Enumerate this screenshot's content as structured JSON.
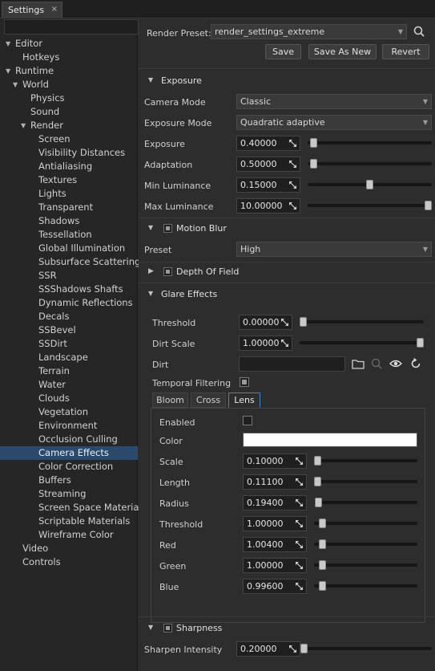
{
  "tab": {
    "title": "Settings",
    "close": "×"
  },
  "tree": [
    {
      "label": "Editor",
      "indent": 0,
      "arrow": "▼"
    },
    {
      "label": "Hotkeys",
      "indent": 1
    },
    {
      "label": "Runtime",
      "indent": 0,
      "arrow": "▼"
    },
    {
      "label": "World",
      "indent": 1,
      "arrow": "▼"
    },
    {
      "label": "Physics",
      "indent": 2
    },
    {
      "label": "Sound",
      "indent": 2
    },
    {
      "label": "Render",
      "indent": 2,
      "arrow": "▼"
    },
    {
      "label": "Screen",
      "indent": 3
    },
    {
      "label": "Visibility Distances",
      "indent": 3
    },
    {
      "label": "Antialiasing",
      "indent": 3
    },
    {
      "label": "Textures",
      "indent": 3
    },
    {
      "label": "Lights",
      "indent": 3
    },
    {
      "label": "Transparent",
      "indent": 3
    },
    {
      "label": "Shadows",
      "indent": 3
    },
    {
      "label": "Tessellation",
      "indent": 3
    },
    {
      "label": "Global Illumination",
      "indent": 3
    },
    {
      "label": "Subsurface Scattering",
      "indent": 3
    },
    {
      "label": "SSR",
      "indent": 3
    },
    {
      "label": "SSShadows Shafts",
      "indent": 3
    },
    {
      "label": "Dynamic Reflections",
      "indent": 3
    },
    {
      "label": "Decals",
      "indent": 3
    },
    {
      "label": "SSBevel",
      "indent": 3
    },
    {
      "label": "SSDirt",
      "indent": 3
    },
    {
      "label": "Landscape",
      "indent": 3
    },
    {
      "label": "Terrain",
      "indent": 3
    },
    {
      "label": "Water",
      "indent": 3
    },
    {
      "label": "Clouds",
      "indent": 3
    },
    {
      "label": "Vegetation",
      "indent": 3
    },
    {
      "label": "Environment",
      "indent": 3
    },
    {
      "label": "Occlusion Culling",
      "indent": 3
    },
    {
      "label": "Camera Effects",
      "indent": 3,
      "selected": true
    },
    {
      "label": "Color Correction",
      "indent": 3
    },
    {
      "label": "Buffers",
      "indent": 3
    },
    {
      "label": "Streaming",
      "indent": 3
    },
    {
      "label": "Screen Space Materials",
      "indent": 3
    },
    {
      "label": "Scriptable Materials",
      "indent": 3
    },
    {
      "label": "Wireframe Color",
      "indent": 3
    },
    {
      "label": "Video",
      "indent": 1
    },
    {
      "label": "Controls",
      "indent": 1
    }
  ],
  "preset": {
    "label": "Render Preset:",
    "value": "render_settings_extreme"
  },
  "buttons": {
    "save": "Save",
    "save_as_new": "Save As New",
    "revert": "Revert"
  },
  "exposure": {
    "title": "Exposure",
    "camera_mode_label": "Camera Mode",
    "camera_mode_value": "Classic",
    "exposure_mode_label": "Exposure Mode",
    "exposure_mode_value": "Quadratic adaptive",
    "rows": [
      {
        "label": "Exposure",
        "value": "0.40000",
        "pos": 0.02
      },
      {
        "label": "Adaptation",
        "value": "0.50000",
        "pos": 0.02
      },
      {
        "label": "Min Luminance",
        "value": "0.15000",
        "pos": 0.5
      },
      {
        "label": "Max Luminance",
        "value": "10.00000",
        "pos": 1.0
      }
    ]
  },
  "motion_blur": {
    "title": "Motion Blur",
    "preset_label": "Preset",
    "preset_value": "High"
  },
  "depth_of_field": {
    "title": "Depth Of Field"
  },
  "glare": {
    "title": "Glare Effects",
    "threshold_label": "Threshold",
    "threshold_value": "0.00000",
    "threshold_pos": 0.0,
    "dirt_scale_label": "Dirt Scale",
    "dirt_scale_value": "1.00000",
    "dirt_scale_pos": 1.0,
    "dirt_label": "Dirt",
    "dirt_value": "",
    "temporal_label": "Temporal Filtering",
    "tabs": [
      "Bloom",
      "Cross",
      "Lens"
    ],
    "lens": {
      "enabled_label": "Enabled",
      "color_label": "Color",
      "color_value": "#ffffff",
      "rows": [
        {
          "label": "Scale",
          "value": "0.10000",
          "pos": 0.0
        },
        {
          "label": "Length",
          "value": "0.11100",
          "pos": 0.0
        },
        {
          "label": "Radius",
          "value": "0.19400",
          "pos": 0.01
        },
        {
          "label": "Threshold",
          "value": "1.00000",
          "pos": 0.05
        },
        {
          "label": "Red",
          "value": "1.00400",
          "pos": 0.05
        },
        {
          "label": "Green",
          "value": "1.00000",
          "pos": 0.05
        },
        {
          "label": "Blue",
          "value": "0.99600",
          "pos": 0.05
        }
      ]
    }
  },
  "sharpness": {
    "title": "Sharpness",
    "intensity_label": "Sharpen Intensity",
    "intensity_value": "0.20000",
    "intensity_pos": 0.0
  }
}
